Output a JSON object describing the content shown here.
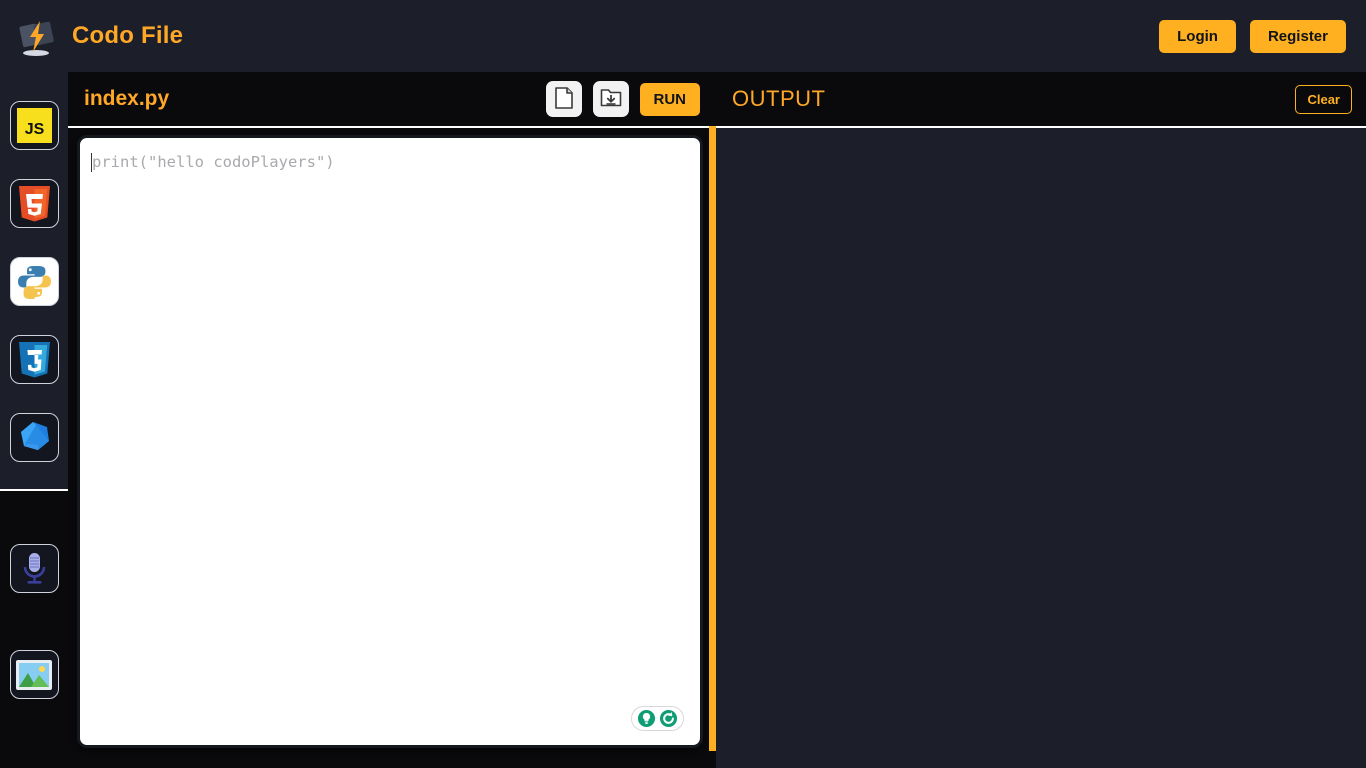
{
  "topbar": {
    "logo_icon": "lightning-bolt-logo-icon",
    "brand_title": "Codo File",
    "login_label": "Login",
    "register_label": "Register"
  },
  "sidebar": {
    "top_items": [
      {
        "id": "javascript",
        "label": "JS",
        "icon": "javascript-icon",
        "active": false
      },
      {
        "id": "html5",
        "label": "HTML5",
        "icon": "html5-icon",
        "active": false
      },
      {
        "id": "python",
        "label": "Python",
        "icon": "python-icon",
        "active": true
      },
      {
        "id": "css3",
        "label": "CSS3",
        "icon": "css3-icon",
        "active": false
      },
      {
        "id": "dart",
        "label": "Dart",
        "icon": "dart-gem-icon",
        "active": false
      }
    ],
    "bottom_items": [
      {
        "id": "microphone",
        "label": "Microphone",
        "icon": "microphone-icon",
        "active": false
      },
      {
        "id": "image",
        "label": "Image",
        "icon": "image-picture-icon",
        "active": false
      }
    ]
  },
  "editor": {
    "filename": "index.py",
    "new_file_icon": "document-page-icon",
    "save_file_icon": "folder-download-icon",
    "run_label": "RUN",
    "code": "print(\"hello codoPlayers\")",
    "helper_icons": [
      "lightbulb-icon",
      "refresh-icon"
    ]
  },
  "output": {
    "title": "OUTPUT",
    "clear_label": "Clear",
    "content": ""
  },
  "colors": {
    "accent": "#ffb020",
    "accent_title": "#ffa726",
    "panel_dark": "#1c1f2a",
    "page_black": "#0a0a0c",
    "divider": "#ffb020",
    "helper_teal": "#0f9d76"
  }
}
